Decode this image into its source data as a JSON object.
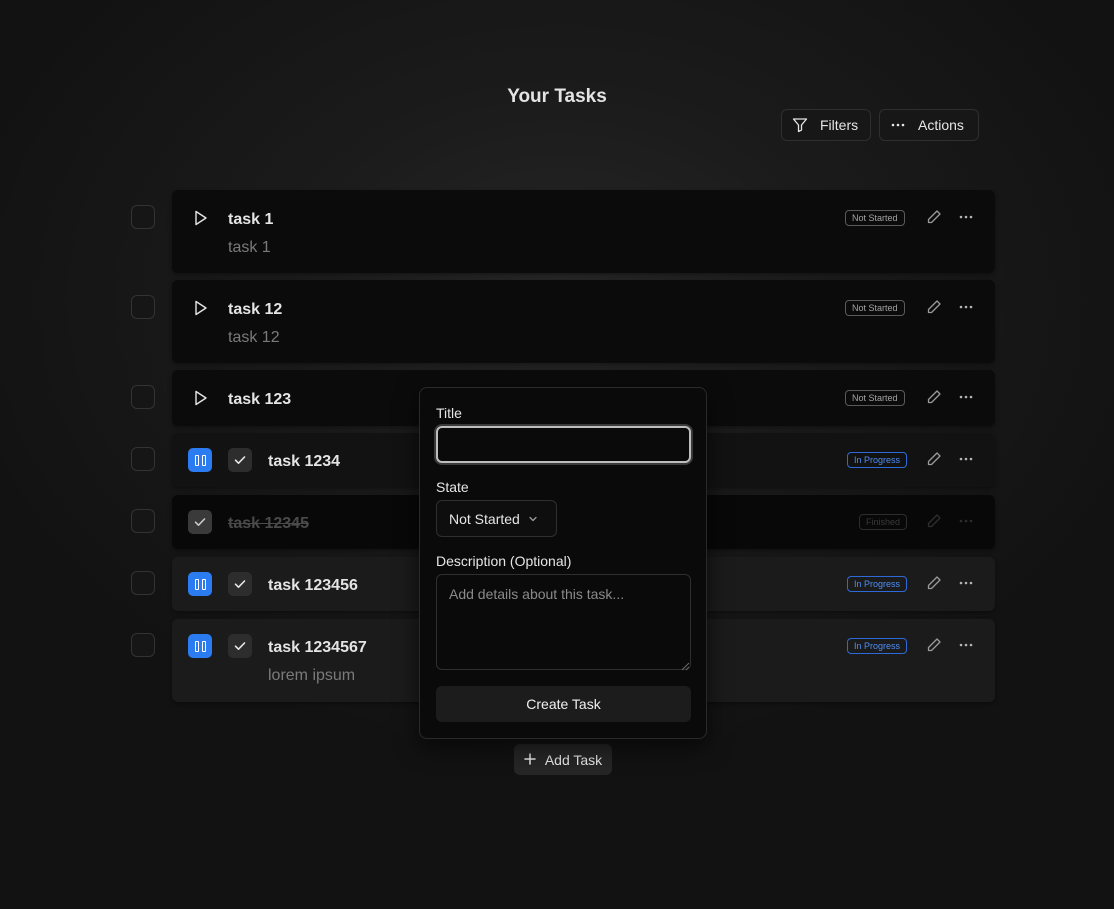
{
  "page": {
    "title": "Your Tasks"
  },
  "toolbar": {
    "filters_label": "Filters",
    "actions_label": "Actions"
  },
  "tasks": [
    {
      "title": "task 1",
      "description": "task 1",
      "status": "Not Started"
    },
    {
      "title": "task 12",
      "description": "task 12",
      "status": "Not Started"
    },
    {
      "title": "task 123",
      "description": "",
      "status": "Not Started"
    },
    {
      "title": "task 1234",
      "description": "",
      "status": "In Progress"
    },
    {
      "title": "task 12345",
      "description": "",
      "status": "Finished"
    },
    {
      "title": "task 123456",
      "description": "",
      "status": "In Progress"
    },
    {
      "title": "task 1234567",
      "description": "lorem ipsum",
      "status": "In Progress"
    }
  ],
  "add_task": {
    "label": "Add Task"
  },
  "create_form": {
    "title_label": "Title",
    "title_value": "",
    "state_label": "State",
    "state_value": "Not Started",
    "description_label": "Description (Optional)",
    "description_placeholder": "Add details about this task...",
    "submit_label": "Create Task"
  },
  "colors": {
    "accent": "#2b7cf0",
    "in_progress": "#4e8ef5",
    "background": "#1b1b1b"
  }
}
